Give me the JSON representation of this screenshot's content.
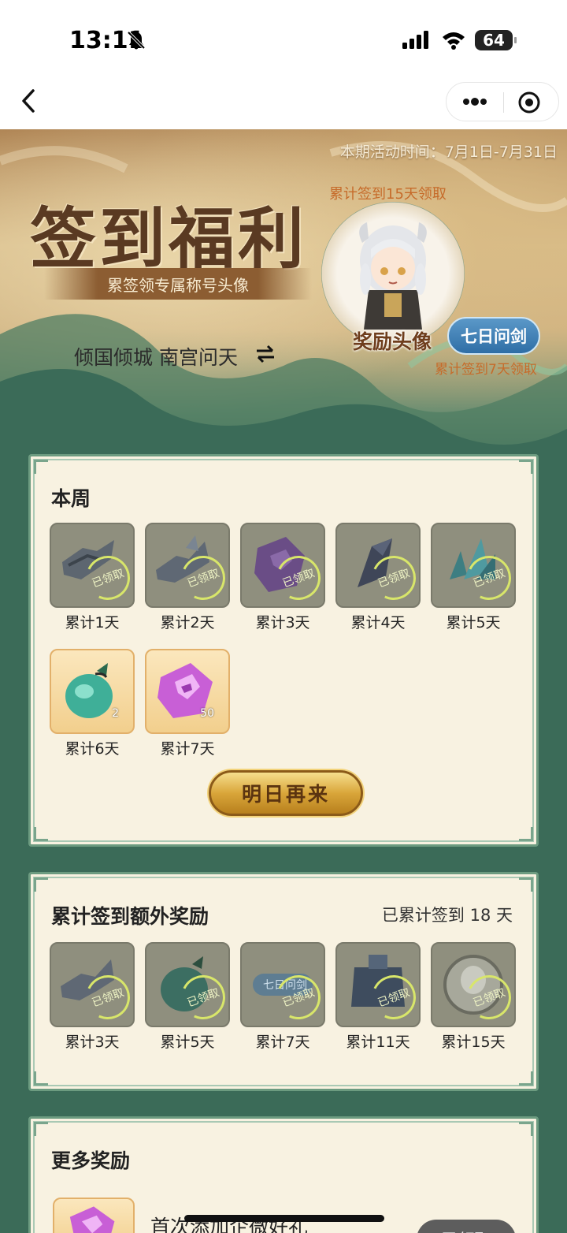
{
  "status_bar": {
    "time": "13:11",
    "battery": "64"
  },
  "banner": {
    "activity_time": "本期活动时间：7月1日-7月31日",
    "title": "签到福利",
    "subtitle": "累签领专属称号头像",
    "user_name": "倾国倾城 南宫问天",
    "accum_15_note": "累计签到15天领取",
    "avatar_label": "奖励头像",
    "title_badge": "七日问剑",
    "accum_7_note": "累计签到7天领取"
  },
  "week_panel": {
    "title": "本周",
    "claimed_label": "已领取",
    "rewards": [
      {
        "label": "累计1天",
        "status": "claimed",
        "icon": "weapon-icon"
      },
      {
        "label": "累计2天",
        "status": "claimed",
        "icon": "weapon-icon"
      },
      {
        "label": "累计3天",
        "status": "claimed",
        "icon": "purple-gem-icon"
      },
      {
        "label": "累计4天",
        "status": "claimed",
        "icon": "dark-crystal-icon"
      },
      {
        "label": "累计5天",
        "status": "claimed",
        "icon": "teal-crystal-icon"
      },
      {
        "label": "累计6天",
        "status": "available",
        "qty": "2",
        "icon": "jade-pouch-icon"
      },
      {
        "label": "累计7天",
        "status": "available",
        "qty": "50",
        "icon": "purple-gem-icon"
      }
    ],
    "button_label": "明日再来"
  },
  "extra_panel": {
    "title": "累计签到额外奖励",
    "summary": "已累计签到 18 天",
    "claimed_label": "已领取",
    "badge_text": "七日问剑",
    "rewards": [
      {
        "label": "累计3天",
        "status": "claimed",
        "icon": "weapon-icon"
      },
      {
        "label": "累计5天",
        "status": "claimed",
        "icon": "jade-pouch-icon"
      },
      {
        "label": "累计7天",
        "status": "claimed",
        "icon": "title-badge-icon"
      },
      {
        "label": "累计11天",
        "status": "claimed",
        "icon": "armor-icon"
      },
      {
        "label": "累计15天",
        "status": "claimed",
        "icon": "avatar-frame-icon"
      }
    ]
  },
  "more_panel": {
    "title": "更多奖励",
    "item_title": "首次添加企微好礼",
    "item_button": "已领取"
  },
  "colors": {
    "panel_bg": "#f8f2e1",
    "panel_border": "#6c9b80",
    "page_bg": "#3b6b58",
    "claimed_ring": "#d8e66a",
    "button_gold": "#d9a63a"
  }
}
